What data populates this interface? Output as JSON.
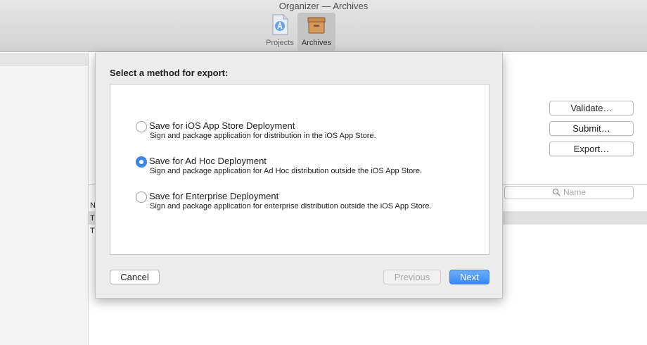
{
  "window": {
    "title": "Organizer — Archives"
  },
  "toolbar": {
    "projects_label": "Projects",
    "archives_label": "Archives",
    "projects_icon": "app-document-icon",
    "archives_icon": "archive-box-icon"
  },
  "archive_actions": {
    "validate": "Validate…",
    "submit": "Submit…",
    "export": "Export…"
  },
  "search": {
    "placeholder": "Name"
  },
  "table": {
    "header_char": "N",
    "row1_char": "T",
    "row2_char": "T"
  },
  "dialog": {
    "heading": "Select a method for export:",
    "options": [
      {
        "title": "Save for iOS App Store Deployment",
        "description": "Sign and package application for distribution in the iOS App Store.",
        "selected": false
      },
      {
        "title": "Save for Ad Hoc Deployment",
        "description": "Sign and package application for Ad Hoc distribution outside the iOS App Store.",
        "selected": true
      },
      {
        "title": "Save for Enterprise Deployment",
        "description": "Sign and package application for enterprise distribution outside the iOS App Store.",
        "selected": false
      }
    ],
    "cancel_label": "Cancel",
    "previous_label": "Previous",
    "next_label": "Next"
  },
  "colors": {
    "accent": "#3b8af0",
    "toolbar_bg": "#dcdcdc",
    "sheet_bg": "#ececec"
  }
}
